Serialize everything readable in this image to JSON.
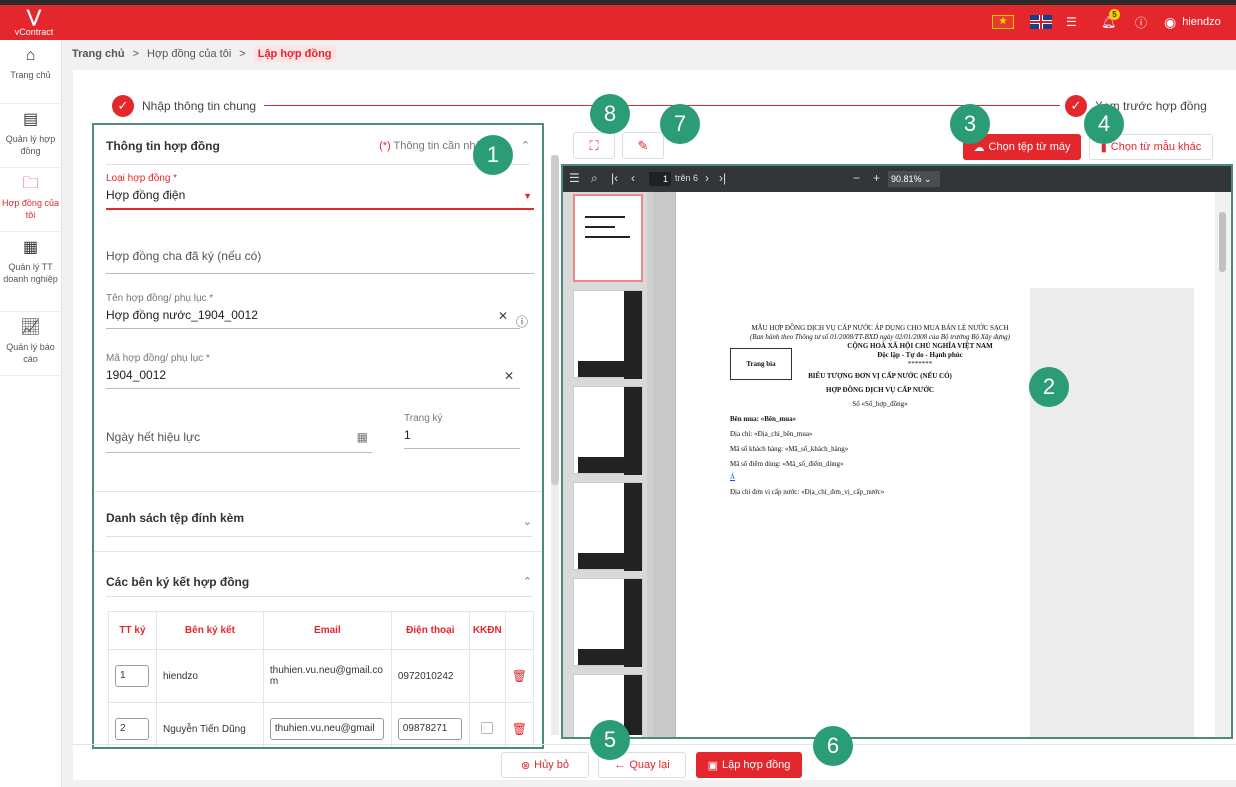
{
  "app": {
    "logo_text": "vContract",
    "user": "hiendzo",
    "notification_count": "5"
  },
  "sidebar": {
    "items": [
      {
        "label": "Trang chủ",
        "icon": "home-icon"
      },
      {
        "label": "Quản lý hợp đồng",
        "icon": "document-icon"
      },
      {
        "label": "Hợp đồng của tôi",
        "icon": "folder-icon",
        "active": true
      },
      {
        "label": "Quản lý TT doanh nghiệp",
        "icon": "building-icon"
      },
      {
        "label": "Quản lý báo cáo",
        "icon": "chart-icon"
      }
    ]
  },
  "breadcrumb": {
    "home": "Trang chủ",
    "mine": "Hợp đồng của tôi",
    "current": "Lập hợp đồng"
  },
  "steps": {
    "step1": "Nhập thông tin chung",
    "step2": "Xem trước hợp đồng"
  },
  "contract_info": {
    "title": "Thông tin hợp đồng",
    "required_note_star": "(*)",
    "required_note": "Thông tin cần nhập",
    "type_label": "Loại hợp đồng *",
    "type_value": "Hợp đồng điện",
    "parent_placeholder": "Hợp đồng cha đã ký (nếu có)",
    "name_label": "Tên hợp đồng/ phụ lục *",
    "name_value": "Hợp đồng nước_1904_0012",
    "code_label": "Mã hợp đồng/ phụ lục *",
    "code_value": "1904_0012",
    "expiry_placeholder": "Ngày hết hiệu lực",
    "sign_page_label": "Trang ký",
    "sign_page_value": "1"
  },
  "attachments": {
    "title": "Danh sách tệp đính kèm"
  },
  "signers": {
    "title": "Các bên ký kết hợp đồng",
    "headers": [
      "TT ký",
      "Bên ký kết",
      "Email",
      "Điện thoại",
      "KKĐN"
    ],
    "rows": [
      {
        "order": "1",
        "name": "hiendzo",
        "email": "thuhien.vu.neu@gmail.com",
        "phone": "0972010242"
      },
      {
        "order": "2",
        "name": "Nguyễn Tiến Dũng",
        "email": "thuhien.vu.neu@gmail",
        "phone": "09878271"
      }
    ]
  },
  "upload": {
    "from_machine": "Chọn tệp từ máy",
    "from_template": "Chọn từ mẫu khác"
  },
  "viewer": {
    "page_current": "1",
    "page_total_text": "trên 6",
    "zoom": "90.81%",
    "doc": {
      "line1": "MẪU HỢP ĐỒNG DỊCH VỤ CẤP NƯỚC ÁP DỤNG CHO MUA BÁN LẺ NƯỚC SẠCH",
      "line2": "(Ban hành theo Thông tư số 01/2008/TT-BXD ngày 02/01/2008 của Bộ trưởng Bộ Xây dựng)",
      "line3": "CỘNG HOÀ XÃ HỘI CHỦ NGHĨA VIỆT NAM",
      "line4": "Độc lập - Tự do - Hạnh phúc",
      "line5": "*******",
      "cover": "Trang bìa",
      "line6": "BIỂU TƯỢNG ĐƠN VỊ CẤP NƯỚC (NẾU CÓ)",
      "line7": "HỢP ĐỒNG DỊCH VỤ CẤP NƯỚC",
      "line8": "Số «Số_hợp_đồng»",
      "f1": "Bên mua: «Bên_mua»",
      "f2": "Địa chỉ: «Địa_chỉ_bên_mua»",
      "f3": "Mã số khách hàng: «Mã_số_khách_hàng»",
      "f4": "Mã số điểm dùng: «Mã_số_điểm_dùng»",
      "f5": "Á",
      "f6": "Địa chỉ đơn vị cấp nước: «Địa_chỉ_đơn_vị_cấp_nước»"
    }
  },
  "actions": {
    "cancel": "Hủy bỏ",
    "back": "Quay lại",
    "create": "Lập hợp đồng"
  },
  "annotations": [
    "1",
    "2",
    "3",
    "4",
    "5",
    "6",
    "7",
    "8"
  ],
  "colors": {
    "brand": "#e4262d",
    "badge": "#2a9d74",
    "highlight_border": "#4e8b7f"
  }
}
